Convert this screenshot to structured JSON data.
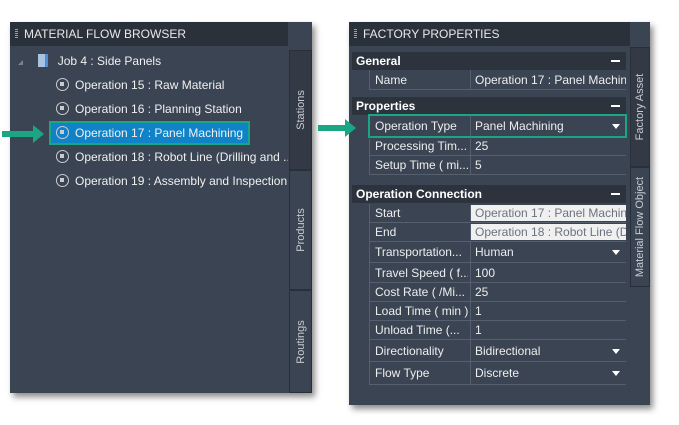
{
  "browser": {
    "title": "MATERIAL FLOW BROWSER",
    "job": "Job 4 : Side Panels",
    "operations": [
      "Operation 15 : Raw Material",
      "Operation 16 : Planning Station",
      "Operation 17 : Panel Machining",
      "Operation 18 : Robot Line (Drilling and ...",
      "Operation 19 : Assembly and Inspection"
    ],
    "selected_index": 2,
    "tabs": [
      "Stations",
      "Products",
      "Routings"
    ]
  },
  "properties": {
    "title": "FACTORY PROPERTIES",
    "tabs": [
      "Factory Asset",
      "Material Flow Object"
    ],
    "sections": {
      "general": {
        "label": "General",
        "rows": [
          {
            "label": "Name",
            "value": "Operation 17 : Panel Machin"
          }
        ]
      },
      "properties": {
        "label": "Properties",
        "rows": [
          {
            "label": "Operation Type",
            "value": "Panel Machining"
          },
          {
            "label": "Processing Tim...",
            "value": "25"
          },
          {
            "label": "Setup Time ( mi...",
            "value": "5"
          }
        ]
      },
      "connection": {
        "label": "Operation Connection",
        "rows": [
          {
            "label": "Start",
            "value": "Operation 17 : Panel Machin"
          },
          {
            "label": "End",
            "value": "Operation 18 : Robot Line (D"
          },
          {
            "label": "Transportation...",
            "value": "Human"
          },
          {
            "label": "Travel Speed ( f...",
            "value": "100"
          },
          {
            "label": "Cost Rate ( /Mi...",
            "value": "25"
          },
          {
            "label": "Load Time ( min )",
            "value": "1"
          },
          {
            "label": "Unload Time (...",
            "value": "1"
          },
          {
            "label": "Directionality",
            "value": "Bidirectional"
          },
          {
            "label": "Flow Type",
            "value": "Discrete"
          }
        ]
      }
    }
  },
  "accent": "#1aa585"
}
